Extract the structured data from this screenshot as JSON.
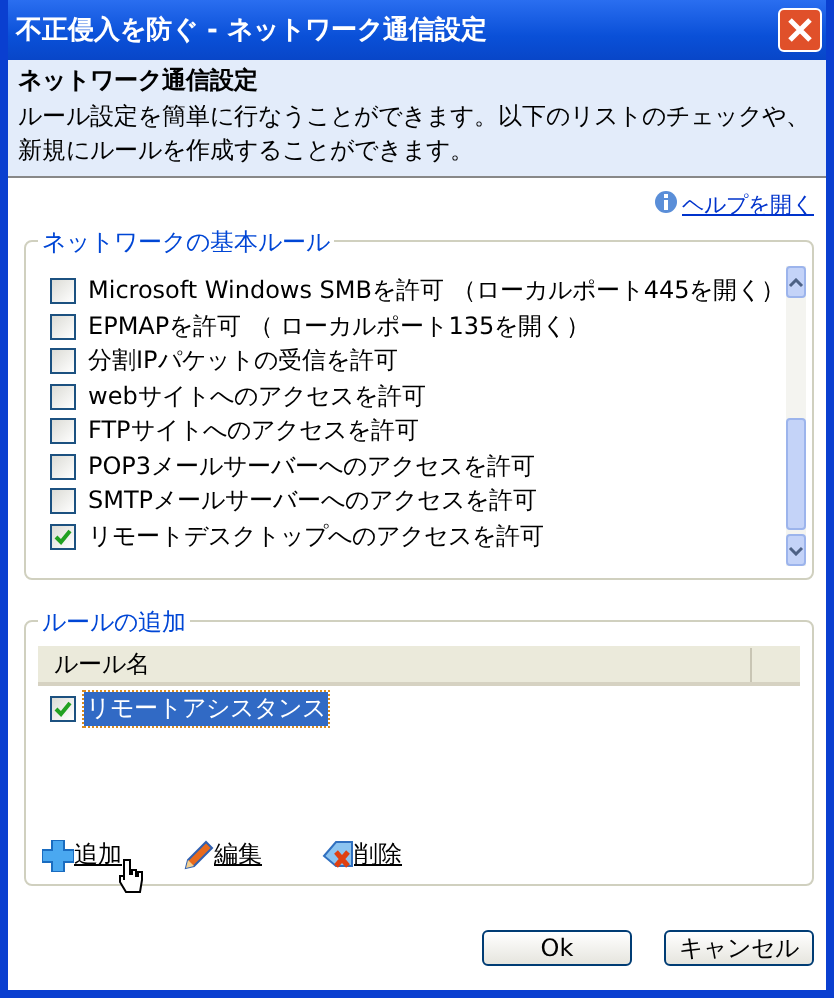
{
  "window": {
    "title": "不正侵入を防ぐ - ネットワーク通信設定"
  },
  "header": {
    "title": "ネットワーク通信設定",
    "description": "ルール設定を簡単に行なうことができます。以下のリストのチェックや、新規にルールを作成することができます。"
  },
  "help_link": "ヘルプを開く",
  "basic_rules": {
    "title": "ネットワークの基本ルール",
    "items": [
      {
        "label": "Microsoft Windows SMBを許可 （ローカルポート445を開く）",
        "checked": false
      },
      {
        "label": "EPMAPを許可 （ ローカルポート135を開く）",
        "checked": false
      },
      {
        "label": "分割IPパケットの受信を許可",
        "checked": false
      },
      {
        "label": "webサイトへのアクセスを許可",
        "checked": false
      },
      {
        "label": "FTPサイトへのアクセスを許可",
        "checked": false
      },
      {
        "label": "POP3メールサーバーへのアクセスを許可",
        "checked": false
      },
      {
        "label": "SMTPメールサーバーへのアクセスを許可",
        "checked": false
      },
      {
        "label": "リモートデスクトップへのアクセスを許可",
        "checked": true
      }
    ]
  },
  "custom_rules": {
    "title": "ルールの追加",
    "column": "ルール名",
    "rows": [
      {
        "label": "リモートアシスタンス",
        "checked": true,
        "selected": true
      }
    ],
    "actions": [
      {
        "kind": "add",
        "label": "追加"
      },
      {
        "kind": "edit",
        "label": "編集"
      },
      {
        "kind": "delete",
        "label": "削除"
      }
    ]
  },
  "buttons": [
    "Ok",
    "キャンセル"
  ]
}
